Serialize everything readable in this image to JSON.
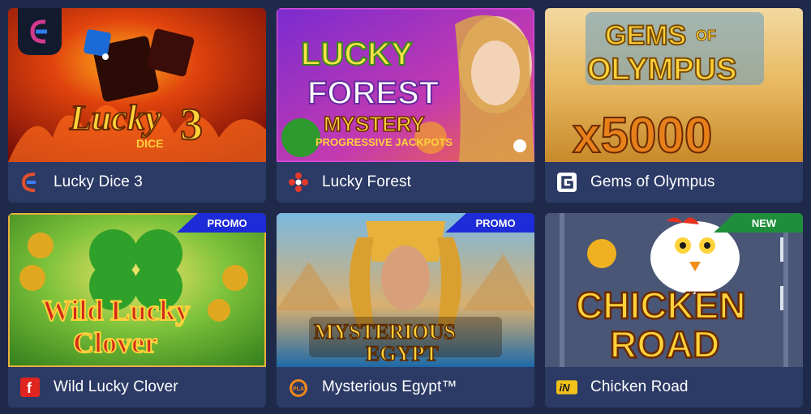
{
  "cards": [
    {
      "title": "Lucky Dice 3",
      "provider_icon": "endorphina-icon",
      "art_text_1": "Lucky",
      "art_text_2": "DICE",
      "art_text_3": "3"
    },
    {
      "title": "Lucky Forest",
      "provider_icon": "dots-provider-icon",
      "art_text_1": "LUCKY",
      "art_text_2": "FOREST",
      "art_text_3": "MYSTERY",
      "art_text_4": "PROGRESSIVE JACKPOTS"
    },
    {
      "title": "Gems of Olympus",
      "provider_icon": "g-provider-icon",
      "art_text_1": "GEMS",
      "art_text_2": "OF",
      "art_text_3": "OLYMPUS",
      "art_text_4": "x5000"
    },
    {
      "title": "Wild Lucky Clover",
      "provider_icon": "f-provider-icon",
      "badge": "PROMO",
      "art_text_1": "Wild Lucky",
      "art_text_2": "Clover"
    },
    {
      "title": "Mysterious Egypt™",
      "provider_icon": "play-provider-icon",
      "badge": "PROMO",
      "art_text_1": "MYSTERIOUS",
      "art_text_2": "EGYPT"
    },
    {
      "title": "Chicken Road",
      "provider_icon": "in-provider-icon",
      "badge": "NEW",
      "art_text_1": "CHICKEN",
      "art_text_2": "ROAD"
    }
  ],
  "colors": {
    "page_bg": "#1f2a4a",
    "card_footer": "#2c3a66",
    "promo": "#1d2bd8",
    "new": "#1f8e3a"
  }
}
